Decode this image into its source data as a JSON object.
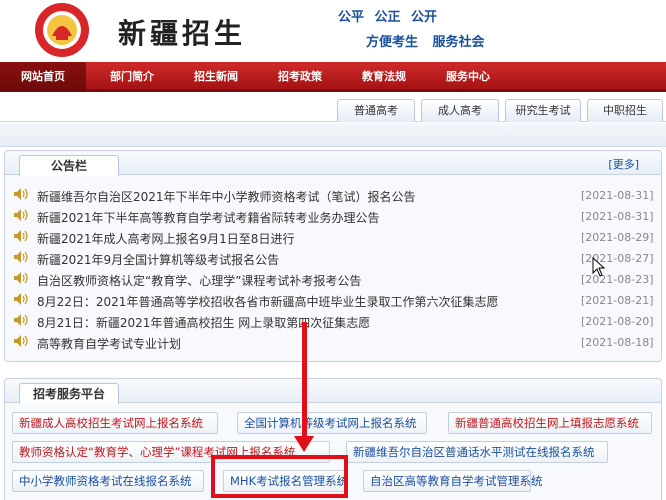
{
  "header": {
    "logo_text": "新疆招生",
    "title": "新疆招生",
    "slogan_line1": "公平 公正 公开",
    "slogan_line2": "方便考生 服务社会"
  },
  "nav": {
    "items": [
      {
        "label": "网站首页",
        "active": true
      },
      {
        "label": "部门简介",
        "active": false
      },
      {
        "label": "招生新闻",
        "active": false
      },
      {
        "label": "招考政策",
        "active": false
      },
      {
        "label": "教育法规",
        "active": false
      },
      {
        "label": "服务中心",
        "active": false
      }
    ]
  },
  "subtabs": [
    "普通高考",
    "成人高考",
    "研究生考试",
    "中职招生"
  ],
  "notice": {
    "title": "公告栏",
    "more": "[更多]",
    "items": [
      {
        "text": "新疆维吾尔自治区2021年下半年中小学教师资格考试（笔试）报名公告",
        "date": "[2021-08-31]"
      },
      {
        "text": "新疆2021年下半年高等教育自学考试考籍省际转考业务办理公告",
        "date": "[2021-08-31]"
      },
      {
        "text": "新疆2021年成人高考网上报名9月1日至8日进行",
        "date": "[2021-08-29]"
      },
      {
        "text": "新疆2021年9月全国计算机等级考试报名公告",
        "date": "[2021-08-27]"
      },
      {
        "text": "自治区教师资格认定“教育学、心理学”课程考试补考报考公告",
        "date": "[2021-08-23]"
      },
      {
        "text": "8月22日：2021年普通高等学校招收各省市新疆高中班毕业生录取工作第六次征集志愿",
        "date": "[2021-08-21]"
      },
      {
        "text": "8月21日：新疆2021年普通高校招生 网上录取第四次征集志愿",
        "date": "[2021-08-20]"
      },
      {
        "text": "高等教育自学考试专业计划",
        "date": "[2021-08-18]"
      }
    ]
  },
  "services": {
    "title": "招考服务平台",
    "rows": [
      [
        {
          "label": "新疆成人高校招生考试网上报名系统",
          "color": "red"
        },
        {
          "label": "全国计算机等级考试网上报名系统",
          "color": "blue"
        },
        {
          "label": "新疆普通高校招生网上填报志愿系统",
          "color": "red"
        }
      ],
      [
        {
          "label": "教师资格认定“教育学、心理学”课程考试网上报名系统",
          "color": "red"
        },
        {
          "label": "新疆维吾尔自治区普通话水平测试在线报名系统",
          "color": "blue"
        }
      ],
      [
        {
          "label": "中小学教师资格考试在线报名系统",
          "color": "blue"
        },
        {
          "label": "MHK考试报名管理系统",
          "color": "blue"
        },
        {
          "label": "自治区高等教育自学考试管理系统",
          "color": "blue"
        }
      ]
    ]
  },
  "colors": {
    "nav_red": "#b81c1c",
    "highlight_red": "#e0101a",
    "link_blue": "#1b4f9c"
  }
}
